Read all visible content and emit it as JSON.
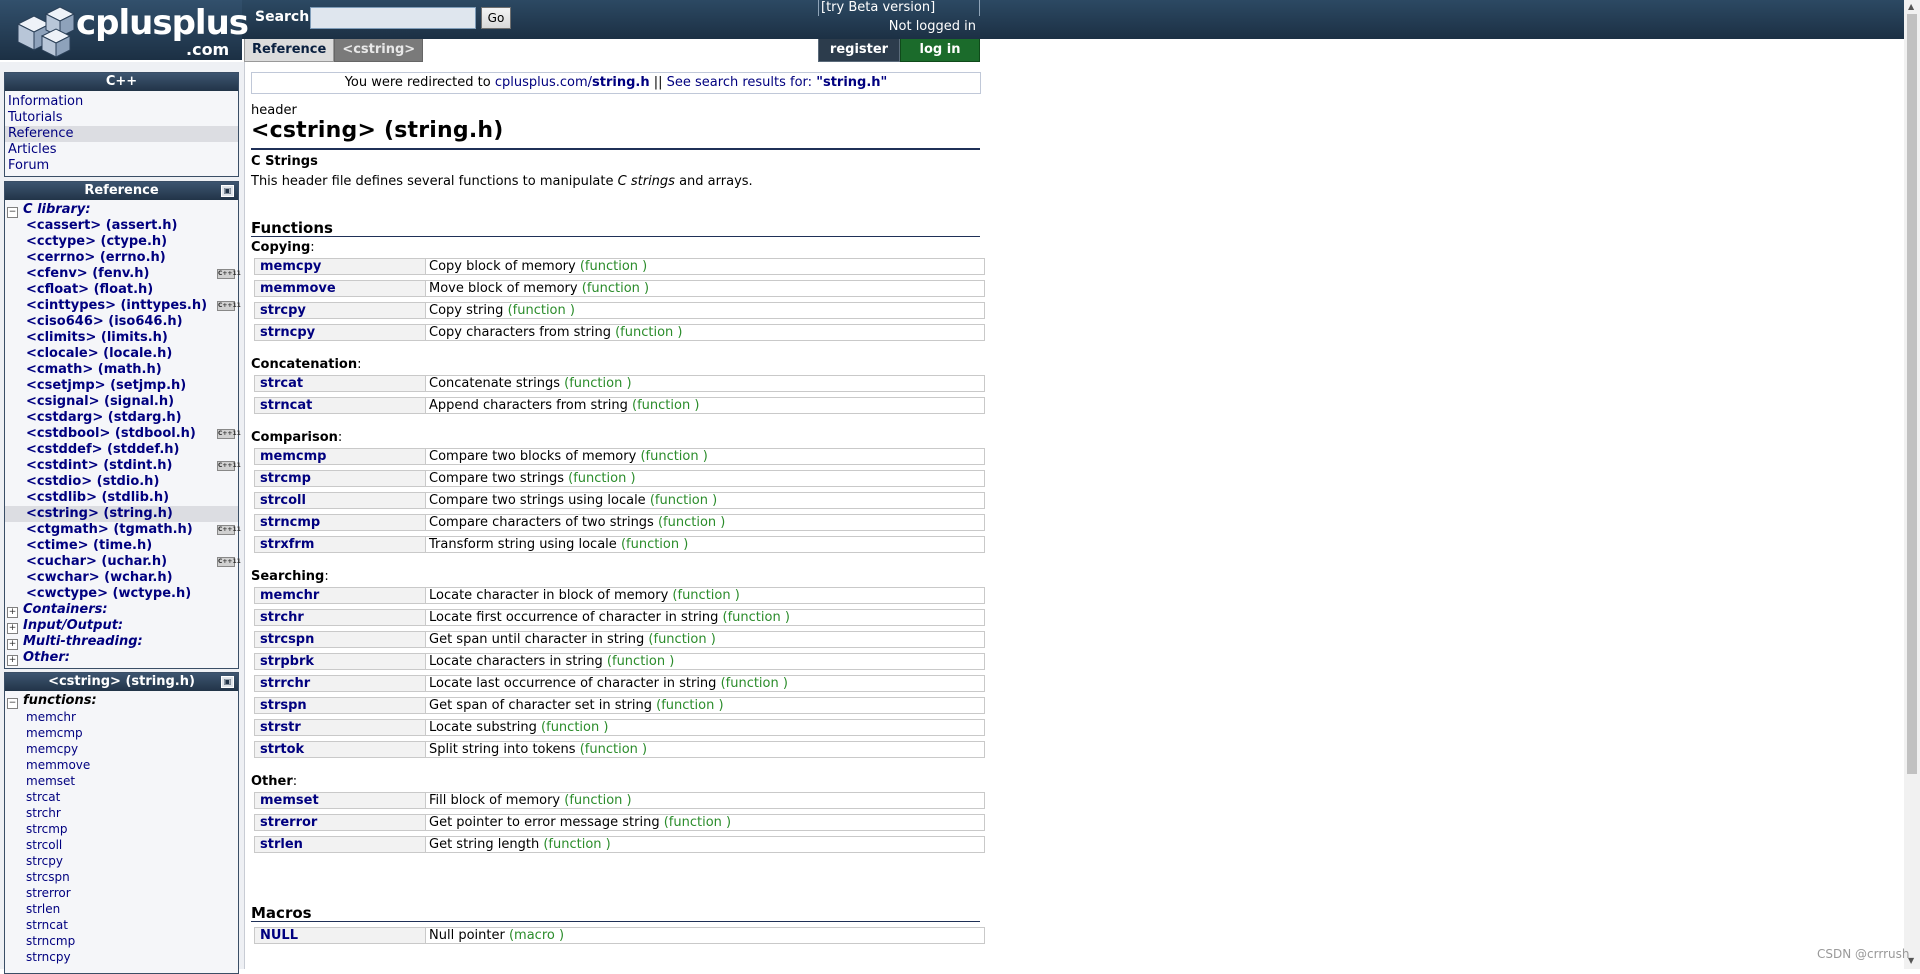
{
  "header": {
    "logo_text": "cplusplus",
    "logo_suffix": ".com",
    "search_label": "Search:",
    "search_value": "",
    "search_button": "Go",
    "beta_link": "[try Beta version]",
    "login_status": "Not logged in",
    "register": "register",
    "login": "log in"
  },
  "breadcrumb": {
    "reference": "Reference",
    "current": "<cstring>"
  },
  "sidebar": {
    "cpp_title": "C++",
    "cpp_items": [
      "Information",
      "Tutorials",
      "Reference",
      "Articles",
      "Forum"
    ],
    "reference_title": "Reference",
    "c_library_label": "C library:",
    "headers": [
      {
        "label": "<cassert> (assert.h)",
        "cpp11": false
      },
      {
        "label": "<cctype> (ctype.h)",
        "cpp11": false
      },
      {
        "label": "<cerrno> (errno.h)",
        "cpp11": false
      },
      {
        "label": "<cfenv> (fenv.h)",
        "cpp11": true
      },
      {
        "label": "<cfloat> (float.h)",
        "cpp11": false
      },
      {
        "label": "<cinttypes> (inttypes.h)",
        "cpp11": true
      },
      {
        "label": "<ciso646> (iso646.h)",
        "cpp11": false
      },
      {
        "label": "<climits> (limits.h)",
        "cpp11": false
      },
      {
        "label": "<clocale> (locale.h)",
        "cpp11": false
      },
      {
        "label": "<cmath> (math.h)",
        "cpp11": false
      },
      {
        "label": "<csetjmp> (setjmp.h)",
        "cpp11": false
      },
      {
        "label": "<csignal> (signal.h)",
        "cpp11": false
      },
      {
        "label": "<cstdarg> (stdarg.h)",
        "cpp11": false
      },
      {
        "label": "<cstdbool> (stdbool.h)",
        "cpp11": true
      },
      {
        "label": "<cstddef> (stddef.h)",
        "cpp11": false
      },
      {
        "label": "<cstdint> (stdint.h)",
        "cpp11": true
      },
      {
        "label": "<cstdio> (stdio.h)",
        "cpp11": false
      },
      {
        "label": "<cstdlib> (stdlib.h)",
        "cpp11": false
      },
      {
        "label": "<cstring> (string.h)",
        "cpp11": false
      },
      {
        "label": "<ctgmath> (tgmath.h)",
        "cpp11": true
      },
      {
        "label": "<ctime> (time.h)",
        "cpp11": false
      },
      {
        "label": "<cuchar> (uchar.h)",
        "cpp11": true
      },
      {
        "label": "<cwchar> (wchar.h)",
        "cpp11": false
      },
      {
        "label": "<cwctype> (wctype.h)",
        "cpp11": false
      }
    ],
    "categories": [
      "Containers:",
      "Input/Output:",
      "Multi-threading:",
      "Other:"
    ],
    "cstring_title": "<cstring> (string.h)",
    "functions_label": "functions:",
    "functions": [
      "memchr",
      "memcmp",
      "memcpy",
      "memmove",
      "memset",
      "strcat",
      "strchr",
      "strcmp",
      "strcoll",
      "strcpy",
      "strcspn",
      "strerror",
      "strlen",
      "strncat",
      "strncmp",
      "strncpy"
    ],
    "cpp11_badge": "C++11"
  },
  "main": {
    "redirect_prefix": "You were redirected to ",
    "redirect_link": "cplusplus.com/string.h",
    "redirect_link_host": "cplusplus.com/",
    "redirect_link_path": "string.h",
    "redirect_separator": " || ",
    "redirect_search": "See search results for: ",
    "redirect_query": "\"string.h\"",
    "kind": "header",
    "title": "<cstring> (string.h)",
    "subtitle": "C Strings",
    "desc_prefix": "This header file defines several functions to manipulate ",
    "desc_em": "C strings",
    "desc_suffix": " and arrays.",
    "functions_title": "Functions",
    "macros_title": "Macros",
    "groups": [
      {
        "title": "Copying",
        "rows": [
          {
            "name": "memcpy",
            "desc": "Copy block of memory",
            "kind": "(function )"
          },
          {
            "name": "memmove",
            "desc": "Move block of memory",
            "kind": "(function )"
          },
          {
            "name": "strcpy",
            "desc": "Copy string",
            "kind": "(function )"
          },
          {
            "name": "strncpy",
            "desc": "Copy characters from string",
            "kind": "(function )"
          }
        ]
      },
      {
        "title": "Concatenation",
        "rows": [
          {
            "name": "strcat",
            "desc": "Concatenate strings",
            "kind": "(function )"
          },
          {
            "name": "strncat",
            "desc": "Append characters from string",
            "kind": "(function )"
          }
        ]
      },
      {
        "title": "Comparison",
        "rows": [
          {
            "name": "memcmp",
            "desc": "Compare two blocks of memory",
            "kind": "(function )"
          },
          {
            "name": "strcmp",
            "desc": "Compare two strings",
            "kind": "(function )"
          },
          {
            "name": "strcoll",
            "desc": "Compare two strings using locale",
            "kind": "(function )"
          },
          {
            "name": "strncmp",
            "desc": "Compare characters of two strings",
            "kind": "(function )"
          },
          {
            "name": "strxfrm",
            "desc": "Transform string using locale",
            "kind": "(function )"
          }
        ]
      },
      {
        "title": "Searching",
        "rows": [
          {
            "name": "memchr",
            "desc": "Locate character in block of memory",
            "kind": "(function )"
          },
          {
            "name": "strchr",
            "desc": "Locate first occurrence of character in string",
            "kind": "(function )"
          },
          {
            "name": "strcspn",
            "desc": "Get span until character in string",
            "kind": "(function )"
          },
          {
            "name": "strpbrk",
            "desc": "Locate characters in string",
            "kind": "(function )"
          },
          {
            "name": "strrchr",
            "desc": "Locate last occurrence of character in string",
            "kind": "(function )"
          },
          {
            "name": "strspn",
            "desc": "Get span of character set in string",
            "kind": "(function )"
          },
          {
            "name": "strstr",
            "desc": "Locate substring",
            "kind": "(function )"
          },
          {
            "name": "strtok",
            "desc": "Split string into tokens",
            "kind": "(function )"
          }
        ]
      },
      {
        "title": "Other",
        "rows": [
          {
            "name": "memset",
            "desc": "Fill block of memory",
            "kind": "(function )"
          },
          {
            "name": "strerror",
            "desc": "Get pointer to error message string",
            "kind": "(function )"
          },
          {
            "name": "strlen",
            "desc": "Get string length",
            "kind": "(function )"
          }
        ]
      }
    ],
    "macros": [
      {
        "name": "NULL",
        "desc": "Null pointer",
        "kind": "(macro )"
      }
    ]
  },
  "watermark": "CSDN @crrrush",
  "colors": {
    "link": "#00007f",
    "kind_green": "#2b8c2b",
    "header_bg": "#223448",
    "login_green": "#1b6b2b"
  }
}
